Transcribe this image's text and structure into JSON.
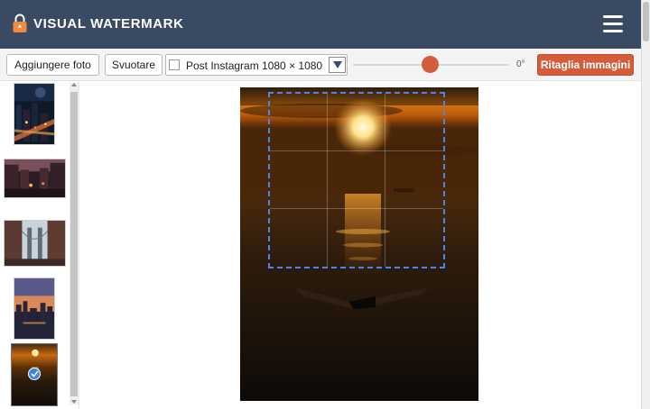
{
  "header": {
    "brand": "VISUAL WATERMARK",
    "logo_icon": "lock-icon",
    "menu_icon": "hamburger-menu-icon",
    "background": "#3a4a63"
  },
  "toolbar": {
    "add_label": "Aggiungere foto",
    "clear_label": "Svuotare",
    "preset_value": "Post Instagram 1080 × 1080",
    "rotation_label": "0°",
    "rotation_value": 0,
    "crop_label": "Ritaglia immagini",
    "accent": "#d35c3a"
  },
  "sidebar": {
    "thumbnails": [
      {
        "name": "city-night-aerial",
        "selected": false
      },
      {
        "name": "street-dusk",
        "selected": false
      },
      {
        "name": "manhattan-bridge",
        "selected": false
      },
      {
        "name": "skyline-sunset",
        "selected": false
      },
      {
        "name": "sea-sunset-boat",
        "selected": true
      }
    ]
  },
  "canvas": {
    "crop_border_color": "#4a86e8"
  }
}
